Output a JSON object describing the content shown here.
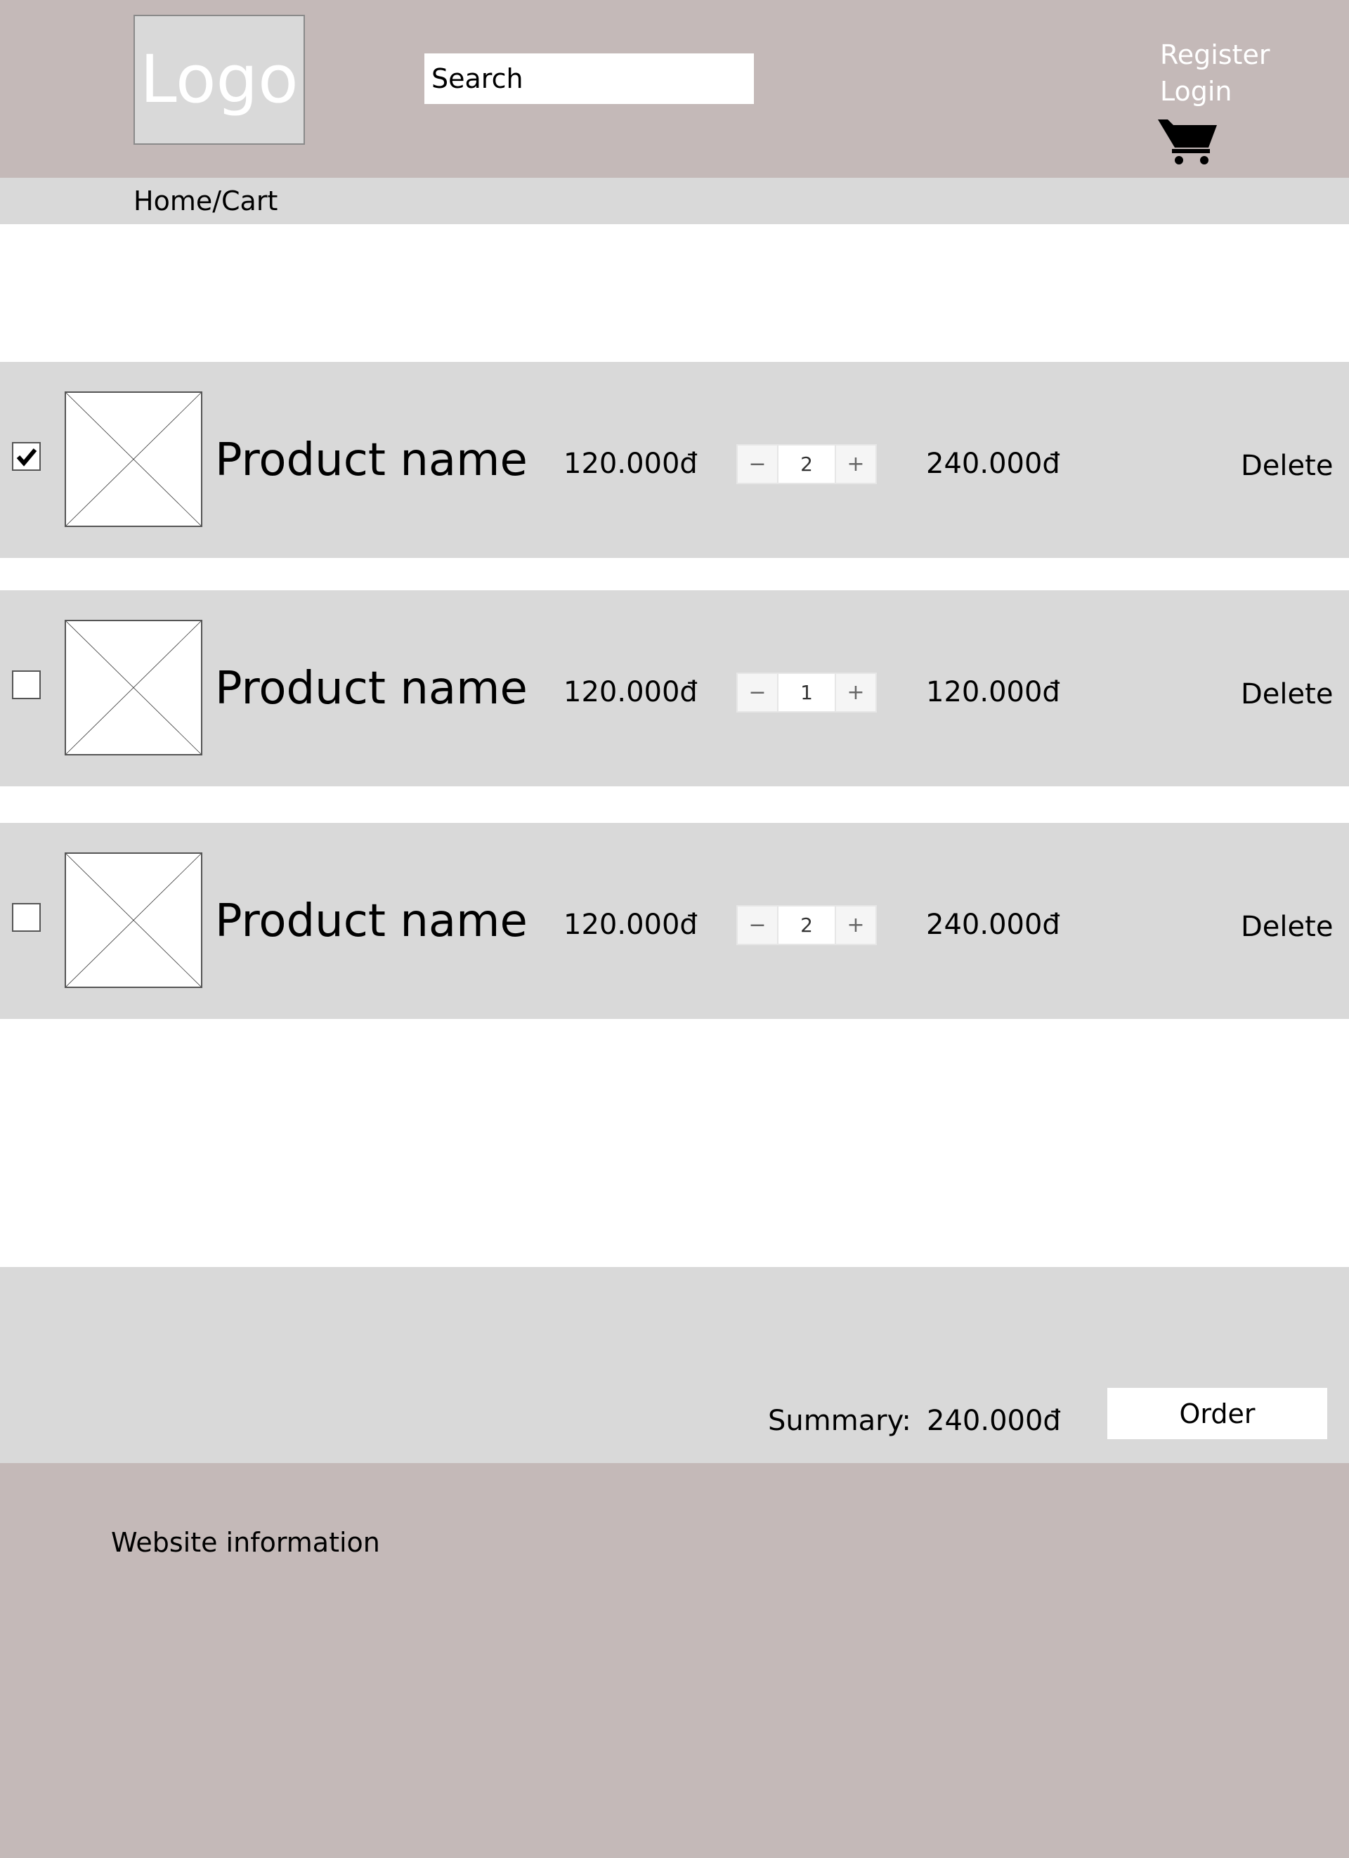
{
  "header": {
    "logo_text": "Logo",
    "search_placeholder": "Search",
    "register_label": "Register",
    "login_label": "Login",
    "cart_icon": "shopping-cart-icon"
  },
  "breadcrumb": "Home/Cart",
  "cart_items": [
    {
      "checked": true,
      "name": "Product name",
      "price": "120.000đ",
      "quantity": "2",
      "total": "240.000đ",
      "delete_label": "Delete"
    },
    {
      "checked": false,
      "name": "Product name",
      "price": "120.000đ",
      "quantity": "1",
      "total": "120.000đ",
      "delete_label": "Delete"
    },
    {
      "checked": false,
      "name": "Product name",
      "price": "120.000đ",
      "quantity": "2",
      "total": "240.000đ",
      "delete_label": "Delete"
    }
  ],
  "quantity_controls": {
    "decrement": "−",
    "increment": "+"
  },
  "summary": {
    "label": "Summary:",
    "amount": "240.000đ",
    "order_label": "Order"
  },
  "footer": {
    "text": "Website information"
  },
  "colors": {
    "header_bg": "#c4b9b8",
    "row_bg": "#d9d9d9",
    "auth_text": "#ffffff"
  }
}
